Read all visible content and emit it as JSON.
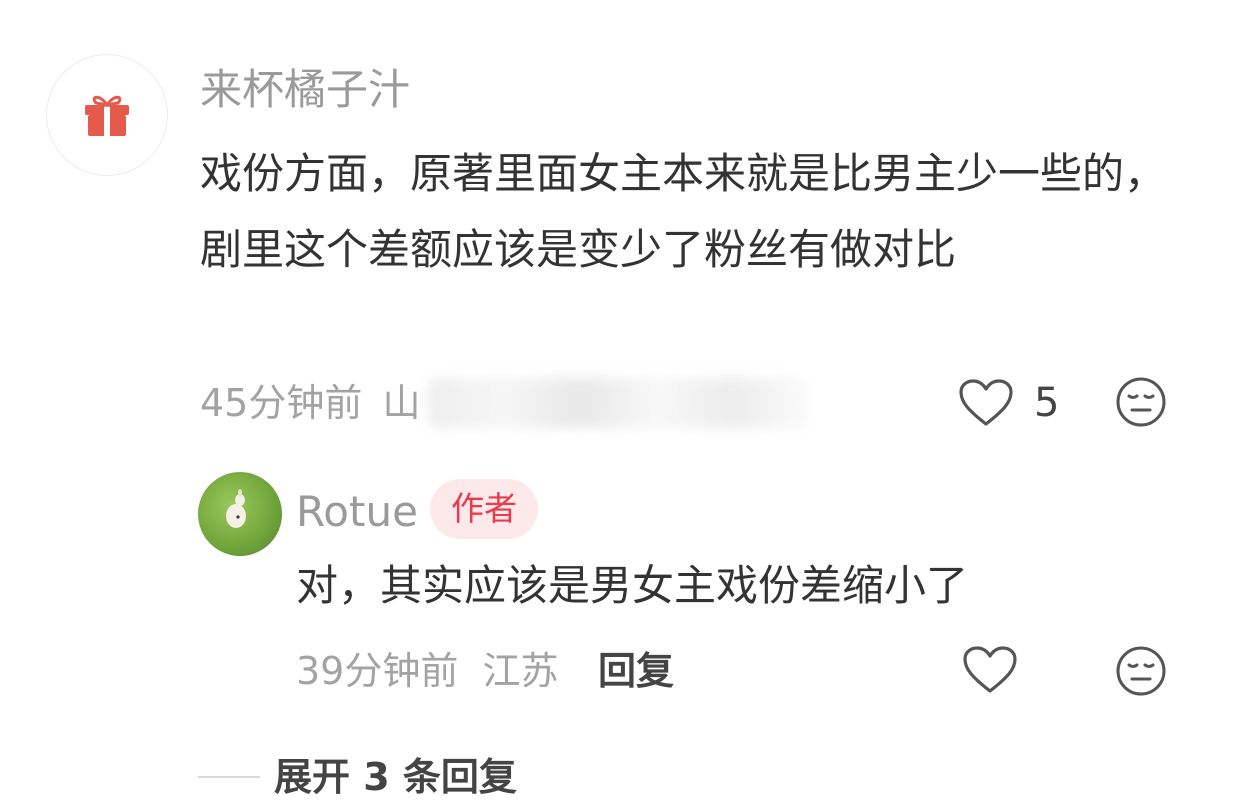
{
  "comment": {
    "username": "来杯橘子汁",
    "text": "戏份方面，原著里面女主本来就是比男主少一些的，剧里这个差额应该是变少了粉丝有做对比",
    "time": "45分钟前",
    "location_visible": "山",
    "like_count": "5"
  },
  "reply": {
    "username": "Rotue",
    "author_badge": "作者",
    "text": "对，其实应该是男女主戏份差缩小了",
    "time": "39分钟前",
    "location": "江苏",
    "reply_label": "回复"
  },
  "expand_label": "展开 3 条回复",
  "colors": {
    "gift_icon": "#e65a4c",
    "author_badge_bg": "#fde8ea",
    "author_badge_text": "#ea3a4e"
  },
  "icons": [
    "gift-icon",
    "heart-outline-icon",
    "meh-face-icon"
  ]
}
